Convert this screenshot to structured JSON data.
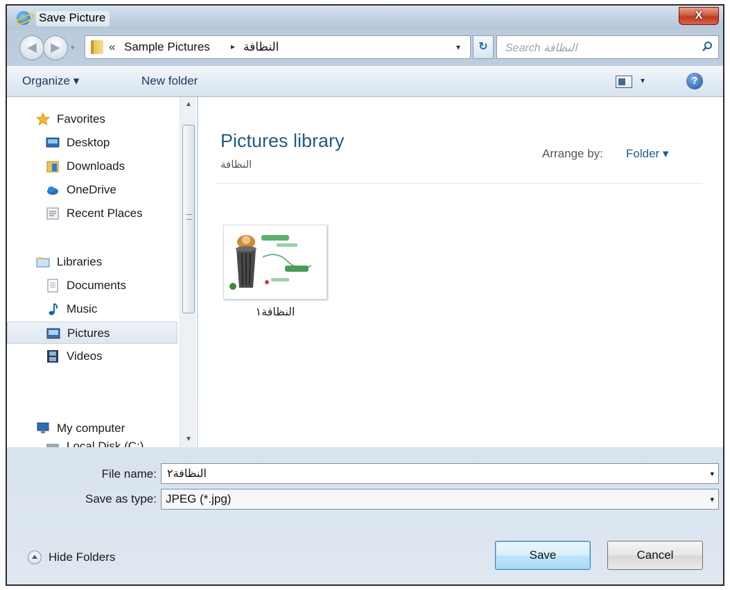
{
  "window": {
    "title": "Save Picture",
    "close_label": "X"
  },
  "address": {
    "overflow": "«",
    "crumbs": [
      "Sample Pictures",
      "النظافة"
    ],
    "separator": "▸",
    "dropdown": "▾",
    "refresh": "↻"
  },
  "search": {
    "placeholder": "Search النظافة"
  },
  "toolbar": {
    "organize_label": "Organize ▾",
    "new_folder_label": "New folder",
    "views_dropdown": "▾",
    "help_label": "?"
  },
  "sidebar": {
    "items": [
      {
        "label": "Favorites",
        "icon": "star-icon"
      },
      {
        "label": "Desktop",
        "icon": "desktop-icon"
      },
      {
        "label": "Downloads",
        "icon": "downloads-folder-icon"
      },
      {
        "label": "OneDrive",
        "icon": "cloud-icon"
      },
      {
        "label": "Recent Places",
        "icon": "recent-places-icon"
      },
      {
        "label": "Libraries",
        "icon": "libraries-icon"
      },
      {
        "label": "Documents",
        "icon": "document-icon"
      },
      {
        "label": "Music",
        "icon": "music-note-icon"
      },
      {
        "label": "Pictures",
        "icon": "pictures-icon"
      },
      {
        "label": "Videos",
        "icon": "video-film-icon"
      },
      {
        "label": "My computer",
        "icon": "computer-icon"
      },
      {
        "label": "Local Disk (C:)",
        "icon": "disk-drive-icon"
      }
    ],
    "selected": "Pictures",
    "scroll_up": "▲",
    "scroll_down": "▼"
  },
  "content": {
    "library_title": "Pictures library",
    "library_subtitle": "النظافة",
    "arrange_by_label": "Arrange by:",
    "arrange_by_value": "Folder ▾",
    "files": [
      {
        "name": "النظافة١"
      }
    ]
  },
  "form": {
    "file_name_label": "File name:",
    "file_name_value": "النظافة٢",
    "save_type_label": "Save as type:",
    "save_type_value": "JPEG (*.jpg)",
    "dropdown_arrow": "▾"
  },
  "footer": {
    "hide_folders_label": "Hide Folders",
    "save_label": "Save",
    "cancel_label": "Cancel"
  },
  "colors": {
    "accent_blue": "#1e5a8a",
    "close_red": "#c03a22",
    "selected_bg": "#dfe6ef"
  }
}
